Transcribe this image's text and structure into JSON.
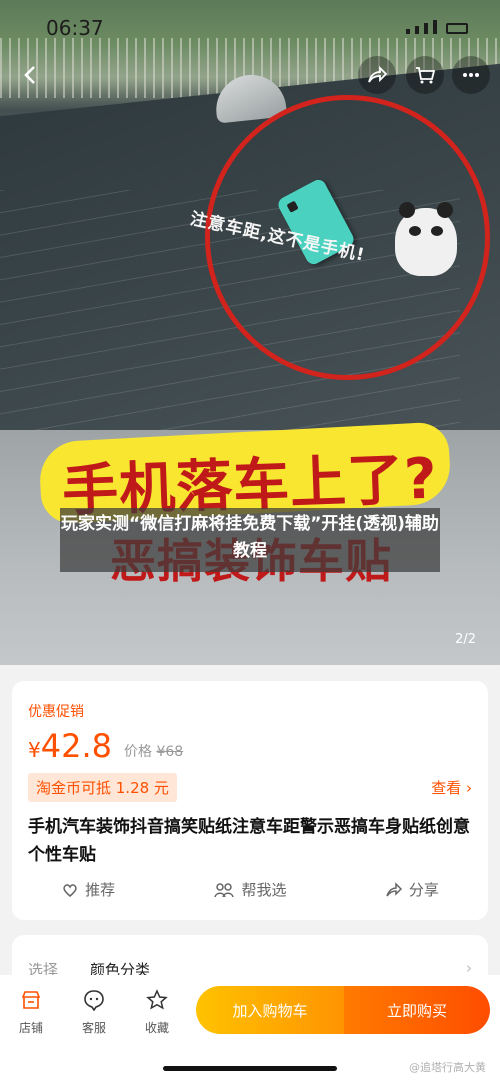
{
  "status_bar": {
    "time": "06:37"
  },
  "hero": {
    "sticker_text": "注意车距,这不是手机!",
    "headline_line1": "手机落车上了?",
    "headline_line2": "恶搞装饰车贴",
    "overlay_title": "玩家实测“微信打麻将挂免费下载”开挂(透视)辅助教程",
    "page_indicator": "2/2"
  },
  "top_buttons": {
    "back_icon": "back-chevron",
    "share_icon": "share-arrow",
    "cart_icon": "cart",
    "more_icon": "more-dots"
  },
  "product": {
    "promo_label": "优惠促销",
    "currency": "¥",
    "price": "42.8",
    "original_label": "价格",
    "original_price": "¥68",
    "coin_badge": "淘金币可抵 1.28 元",
    "view_link": "查看 ›",
    "title": "手机汽车装饰抖音搞笑贴纸注意车距警示恶搞车身贴纸创意个性车贴",
    "actions": [
      {
        "label": "推荐",
        "icon": "heart-outline"
      },
      {
        "label": "帮我选",
        "icon": "people"
      },
      {
        "label": "分享",
        "icon": "share"
      }
    ]
  },
  "select": {
    "label": "选择",
    "value": "颜色分类",
    "arrow": "›"
  },
  "bottom_bar": {
    "nav": [
      {
        "label": "店铺",
        "icon": "store"
      },
      {
        "label": "客服",
        "icon": "chat-face"
      },
      {
        "label": "收藏",
        "icon": "star-outline"
      }
    ],
    "add_to_cart": "加入购物车",
    "buy_now": "立即购买",
    "watermark": "@追塔行高大黄"
  },
  "colors": {
    "accent": "#ff5000",
    "circle_red": "#d2231d",
    "banner_yellow": "#f8e630"
  }
}
